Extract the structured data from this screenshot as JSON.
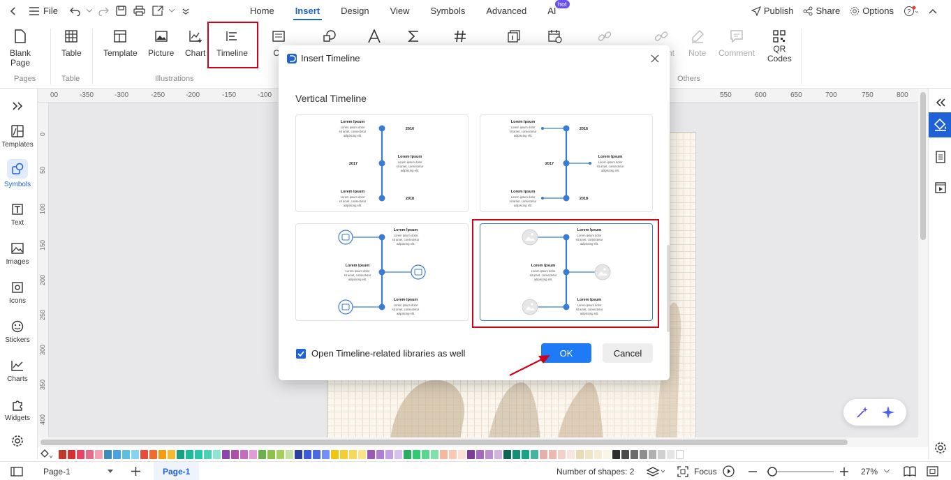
{
  "topbar": {
    "file_label": "File",
    "tabs": [
      {
        "label": "Home"
      },
      {
        "label": "Insert"
      },
      {
        "label": "Design"
      },
      {
        "label": "View"
      },
      {
        "label": "Symbols"
      },
      {
        "label": "Advanced"
      },
      {
        "label": "AI"
      }
    ],
    "active_tab": "Insert",
    "ai_badge": "hot",
    "publish_label": "Publish",
    "share_label": "Share",
    "options_label": "Options"
  },
  "ribbon": {
    "blank_page": "Blank\nPage",
    "table": "Table",
    "template": "Template",
    "picture": "Picture",
    "chart": "Chart",
    "timeline": "Timeline",
    "co_partial": "Co",
    "nt_partial": "nt",
    "note": "Note",
    "comment": "Comment",
    "qr": "QR\nCodes",
    "groups": {
      "pages": "Pages",
      "table": "Table",
      "illustrations": "Illustrations",
      "others": "Others"
    }
  },
  "leftbar": {
    "items": [
      {
        "label": "Templates"
      },
      {
        "label": "Symbols"
      },
      {
        "label": "Text"
      },
      {
        "label": "Images"
      },
      {
        "label": "Icons"
      },
      {
        "label": "Stickers"
      },
      {
        "label": "Charts"
      },
      {
        "label": "Widgets"
      }
    ]
  },
  "ruler": {
    "top": [
      "00",
      "-350",
      "-300",
      "-250",
      "-200",
      "-150",
      "-100",
      "550",
      "600",
      "650",
      "700",
      "750",
      "800"
    ],
    "left": [
      "0",
      "50",
      "100",
      "150",
      "200",
      "250",
      "300",
      "350",
      "400"
    ]
  },
  "dialog": {
    "title": "Insert Timeline",
    "section": "Vertical Timeline",
    "lorem_title": "Lorem Ipsum",
    "lorem_body": "Lorem ipsum dolor sit amet, consectetur adipiscing elit.",
    "years": [
      "2016",
      "2017",
      "2018"
    ],
    "checkbox_label": "Open Timeline-related libraries as well",
    "checkbox_checked": true,
    "ok": "OK",
    "cancel": "Cancel"
  },
  "statusbar": {
    "page_selector": "Page-1",
    "page_tab": "Page-1",
    "shape_count": "Number of shapes: 2",
    "focus": "Focus",
    "zoom": "27%"
  },
  "colors": {
    "accent": "#1e62d6",
    "highlight": "#d0021b",
    "timeline": "#3a7bd5",
    "palette": [
      "#c0392b",
      "#d63031",
      "#e84360",
      "#e56b8a",
      "#f4a0b0",
      "#3c8dbc",
      "#4aa3df",
      "#5bc0de",
      "#85d3ec",
      "#e74c3c",
      "#f06b2f",
      "#f39c12",
      "#f7b731",
      "#16a085",
      "#1abc9c",
      "#26c6a8",
      "#48d1b5",
      "#8ee5d0",
      "#8e44ad",
      "#b04fa8",
      "#c56cc0",
      "#e29ad9",
      "#6ab04c",
      "#8bc34a",
      "#a4cf5a",
      "#c5e1a5",
      "#2c3e9e",
      "#3b5bdb",
      "#4a69e2",
      "#748ffc",
      "#f1c40f",
      "#f5cd2f",
      "#f8d858",
      "#fbe38a",
      "#9b59b6",
      "#b07cd6",
      "#c39ee3",
      "#d7bff0",
      "#27ae60",
      "#2ecc71",
      "#58d68d",
      "#82e0aa",
      "#f2b8a0",
      "#f8c9b4",
      "#fbe0d3",
      "#7d3c98",
      "#a569bd",
      "#bb8fce",
      "#d2b4de",
      "#0e6655",
      "#148f77",
      "#17a589",
      "#45b39d",
      "#e6b0aa",
      "#ecb8b0",
      "#f3d0c8",
      "#f9e5df",
      "#e8dab2",
      "#f0e4c4",
      "#f5ecd6",
      "#fbf5e8",
      "#2d2d2d",
      "#4a4a4a",
      "#6b6b6b",
      "#8e8e8e",
      "#b0b0b0",
      "#d0d0d0",
      "#e5e5e5",
      "#ffffff"
    ]
  }
}
